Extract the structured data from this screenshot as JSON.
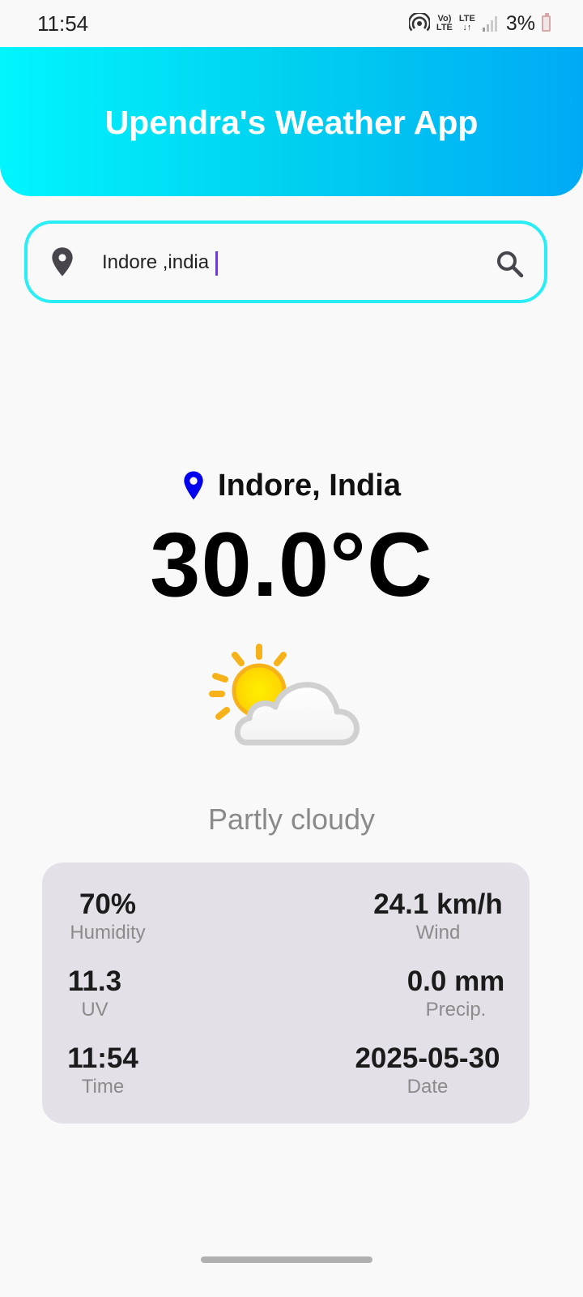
{
  "status_bar": {
    "time": "11:54",
    "volte_top": "Vo)",
    "volte_bottom": "LTE",
    "lte_top": "LTE",
    "lte_bottom": "↓↑",
    "battery_percent": "3%"
  },
  "header": {
    "title": "Upendra's Weather App",
    "gradient_start": "#00f5ff",
    "gradient_end": "#00aaf5"
  },
  "search": {
    "value": "Indore ,india",
    "location_icon": "location-pin-icon",
    "search_icon": "search-icon",
    "border_color": "#29eef5"
  },
  "current": {
    "location": "Indore, India",
    "location_icon_color": "#0000ee",
    "temperature": "30.0°C",
    "condition": "Partly cloudy",
    "condition_icon": "partly-cloudy-icon"
  },
  "stats": {
    "humidity": {
      "value": "70%",
      "label": "Humidity"
    },
    "wind": {
      "value": "24.1 km/h",
      "label": "Wind"
    },
    "uv": {
      "value": "11.3",
      "label": "UV"
    },
    "precip": {
      "value": "0.0 mm",
      "label": "Precip."
    },
    "time": {
      "value": "11:54",
      "label": "Time"
    },
    "date": {
      "value": "2025-05-30",
      "label": "Date"
    }
  }
}
